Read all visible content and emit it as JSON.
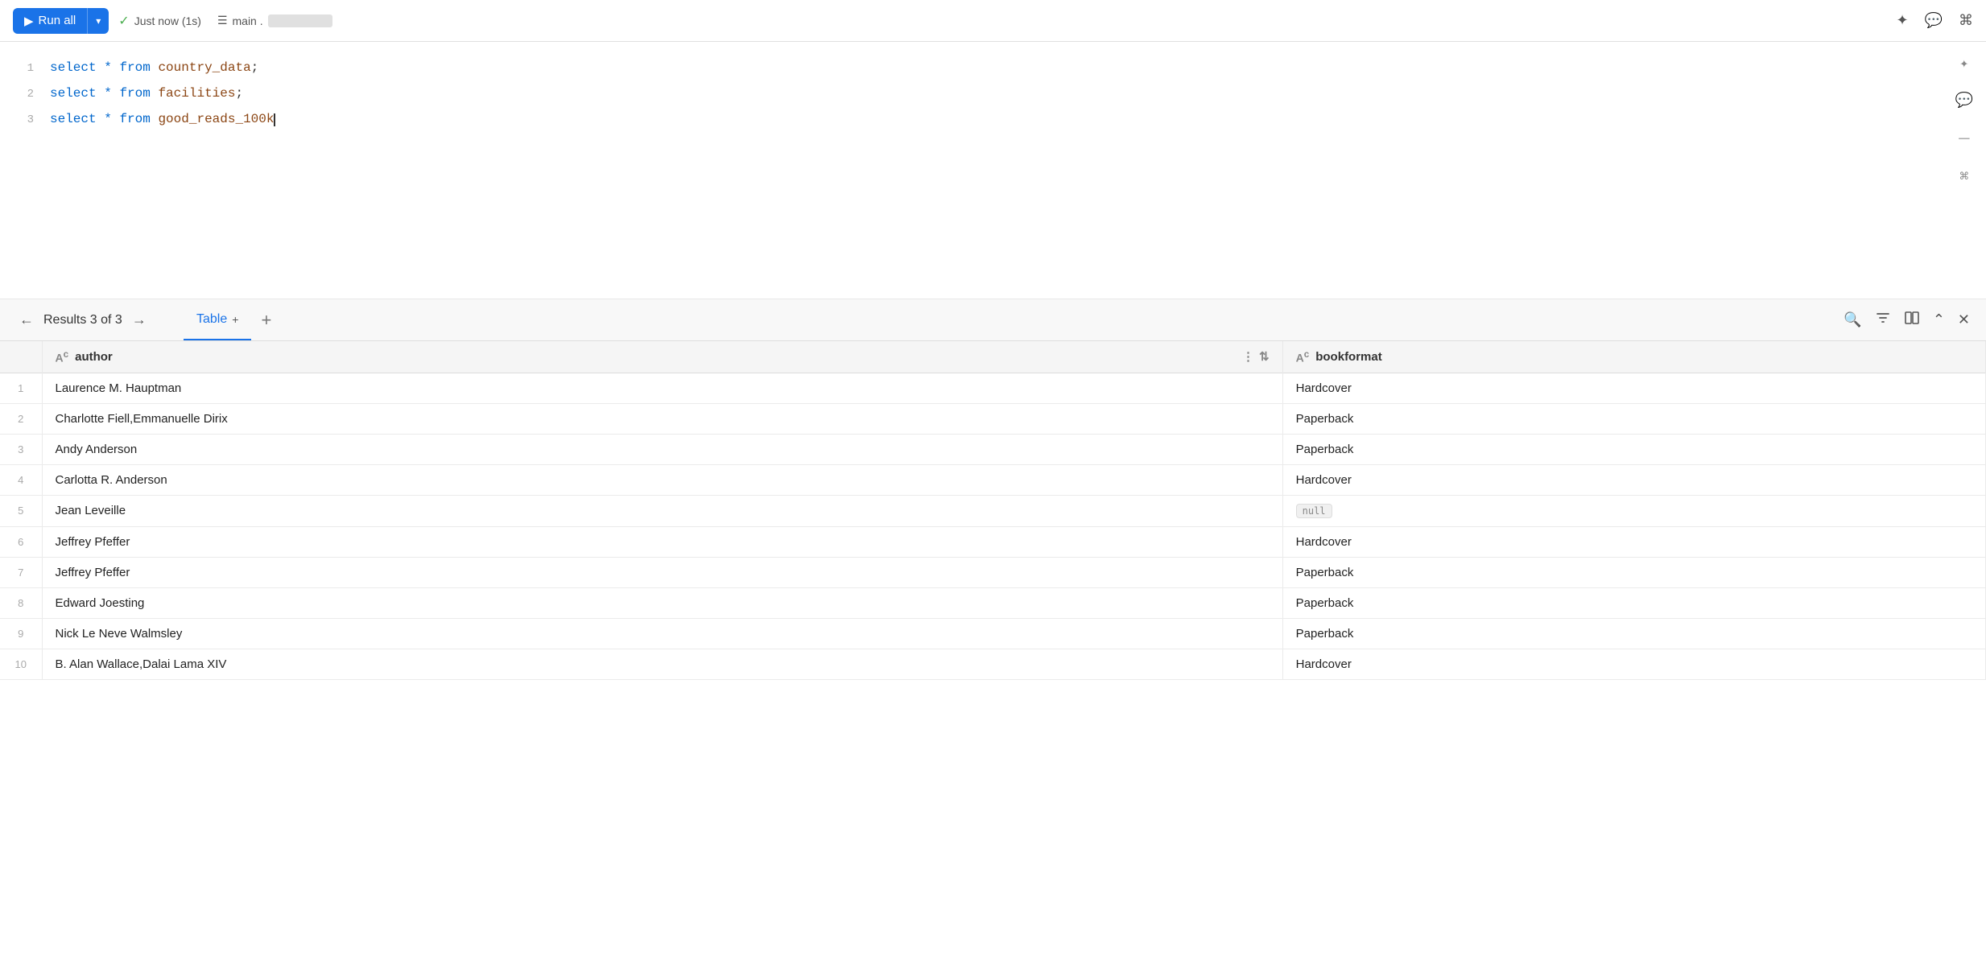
{
  "toolbar": {
    "run_all_label": "Run all",
    "run_icon": "▶",
    "dropdown_icon": "▾",
    "status_check": "✓",
    "status_text": "Just now (1s)",
    "db_icon": "☰",
    "db_label": "main .",
    "spark_icon": "✦",
    "chat_icon": "💬",
    "settings_icon": "⌘"
  },
  "editor": {
    "lines": [
      {
        "num": "1",
        "code": "select * from country_data;"
      },
      {
        "num": "2",
        "code": "select * from facilities;"
      },
      {
        "num": "3",
        "code": "select * from good_reads_100k"
      }
    ]
  },
  "results_bar": {
    "prev_label": "←",
    "next_label": "→",
    "results_label": "Results 3 of 3",
    "table_label": "Table",
    "add_tab": "+",
    "search_icon": "🔍",
    "filter_icon": "⊟",
    "columns_icon": "⊞",
    "collapse_icon": "⌃",
    "close_icon": "✕"
  },
  "table": {
    "columns": [
      {
        "key": "row_num",
        "label": ""
      },
      {
        "key": "author",
        "label": "author",
        "type": "Ac"
      },
      {
        "key": "bookformat",
        "label": "bookformat",
        "type": "Ac"
      }
    ],
    "rows": [
      {
        "row_num": "1",
        "author": "Laurence M. Hauptman",
        "bookformat": "Hardcover"
      },
      {
        "row_num": "2",
        "author": "Charlotte Fiell,Emmanuelle Dirix",
        "bookformat": "Paperback"
      },
      {
        "row_num": "3",
        "author": "Andy Anderson",
        "bookformat": "Paperback"
      },
      {
        "row_num": "4",
        "author": "Carlotta R. Anderson",
        "bookformat": "Hardcover"
      },
      {
        "row_num": "5",
        "author": "Jean Leveille",
        "bookformat": "null"
      },
      {
        "row_num": "6",
        "author": "Jeffrey Pfeffer",
        "bookformat": "Hardcover"
      },
      {
        "row_num": "7",
        "author": "Jeffrey Pfeffer",
        "bookformat": "Paperback"
      },
      {
        "row_num": "8",
        "author": "Edward Joesting",
        "bookformat": "Paperback"
      },
      {
        "row_num": "9",
        "author": "Nick Le Neve Walmsley",
        "bookformat": "Paperback"
      },
      {
        "row_num": "10",
        "author": "B. Alan Wallace,Dalai Lama XIV",
        "bookformat": "Hardcover"
      }
    ]
  },
  "colors": {
    "accent": "#1a73e8",
    "null_bg": "#f0f0f0"
  }
}
